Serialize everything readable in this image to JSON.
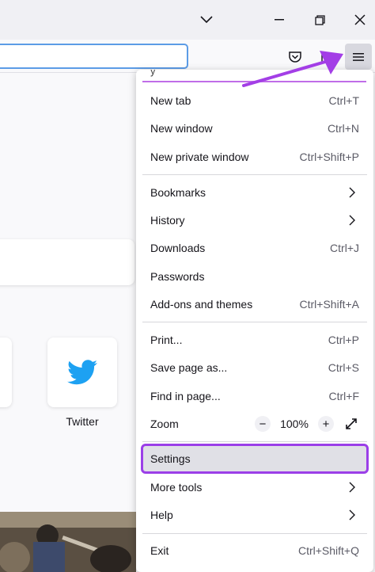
{
  "window": {
    "tabs_dropdown_icon": "chevron-down-icon",
    "minimize_icon": "minimize-icon",
    "restore_icon": "restore-icon",
    "close_icon": "close-icon"
  },
  "toolbar": {
    "url_value": "",
    "pocket_icon": "pocket-icon",
    "extensions_icon": "puzzle-icon",
    "menu_icon": "hamburger-menu-icon"
  },
  "newtab": {
    "shortcuts": [
      {
        "label": "Twitter",
        "icon": "twitter-bird-icon"
      }
    ]
  },
  "app_menu": {
    "groups": [
      [
        {
          "label": "New tab",
          "shortcut": "Ctrl+T"
        },
        {
          "label": "New window",
          "shortcut": "Ctrl+N"
        },
        {
          "label": "New private window",
          "shortcut": "Ctrl+Shift+P"
        }
      ],
      [
        {
          "label": "Bookmarks",
          "submenu": true
        },
        {
          "label": "History",
          "submenu": true
        },
        {
          "label": "Downloads",
          "shortcut": "Ctrl+J"
        },
        {
          "label": "Passwords"
        },
        {
          "label": "Add-ons and themes",
          "shortcut": "Ctrl+Shift+A"
        }
      ],
      [
        {
          "label": "Print...",
          "shortcut": "Ctrl+P"
        },
        {
          "label": "Save page as...",
          "shortcut": "Ctrl+S"
        },
        {
          "label": "Find in page...",
          "shortcut": "Ctrl+F"
        }
      ]
    ],
    "zoom": {
      "label": "Zoom",
      "minus": "−",
      "value": "100%",
      "plus": "+"
    },
    "settings_label": "Settings",
    "more_tools_label": "More tools",
    "help_label": "Help",
    "exit": {
      "label": "Exit",
      "shortcut": "Ctrl+Shift+Q"
    }
  },
  "colors": {
    "highlight_outline": "#9b3fe8",
    "annotation_arrow": "#a33ee6",
    "urlbar_focus": "#5c9ce6",
    "twitter_blue": "#1da1f2"
  }
}
